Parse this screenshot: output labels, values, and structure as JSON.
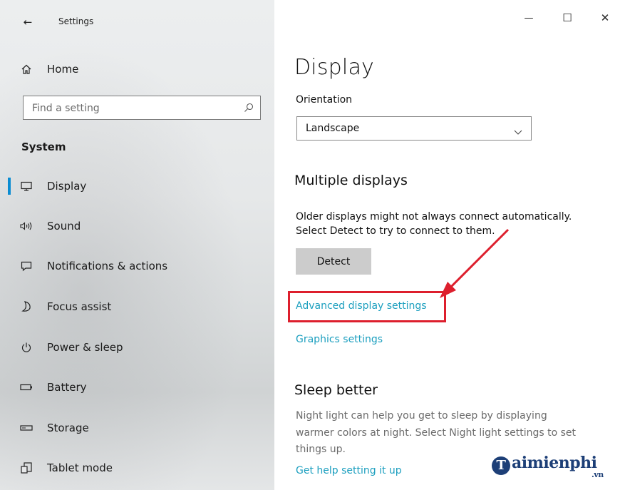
{
  "window": {
    "title": "Settings",
    "minimize_glyph": "—",
    "maximize_glyph": "☐",
    "close_glyph": "✕"
  },
  "sidebar": {
    "home_label": "Home",
    "search_placeholder": "Find a setting",
    "section_label": "System",
    "items": [
      {
        "label": "Display",
        "icon": "monitor-icon",
        "active": true
      },
      {
        "label": "Sound",
        "icon": "speaker-icon"
      },
      {
        "label": "Notifications & actions",
        "icon": "notification-icon"
      },
      {
        "label": "Focus assist",
        "icon": "moon-icon"
      },
      {
        "label": "Power & sleep",
        "icon": "power-icon"
      },
      {
        "label": "Battery",
        "icon": "battery-icon"
      },
      {
        "label": "Storage",
        "icon": "storage-icon"
      },
      {
        "label": "Tablet mode",
        "icon": "tablet-mode-icon"
      }
    ]
  },
  "main": {
    "page_title": "Display",
    "orientation_label": "Orientation",
    "orientation_value": "Landscape",
    "multiple_displays_heading": "Multiple displays",
    "multiple_displays_text_1": "Older displays might not always connect automatically.",
    "multiple_displays_text_2": "Select Detect to try to connect to them.",
    "detect_label": "Detect",
    "advanced_link": "Advanced display settings",
    "graphics_link": "Graphics settings",
    "sleep_heading": "Sleep better",
    "sleep_text_1": "Night light can help you get to sleep by displaying",
    "sleep_text_2": "warmer colors at night. Select Night light settings to set",
    "sleep_text_3": "things up.",
    "help_link": "Get help setting it up"
  },
  "watermark": {
    "letter": "T",
    "text": "aimienphi",
    "suffix": ".vn"
  },
  "colors": {
    "accent": "#0a8cd2",
    "link": "#1c9fbf",
    "highlight": "#dd1f2d"
  }
}
